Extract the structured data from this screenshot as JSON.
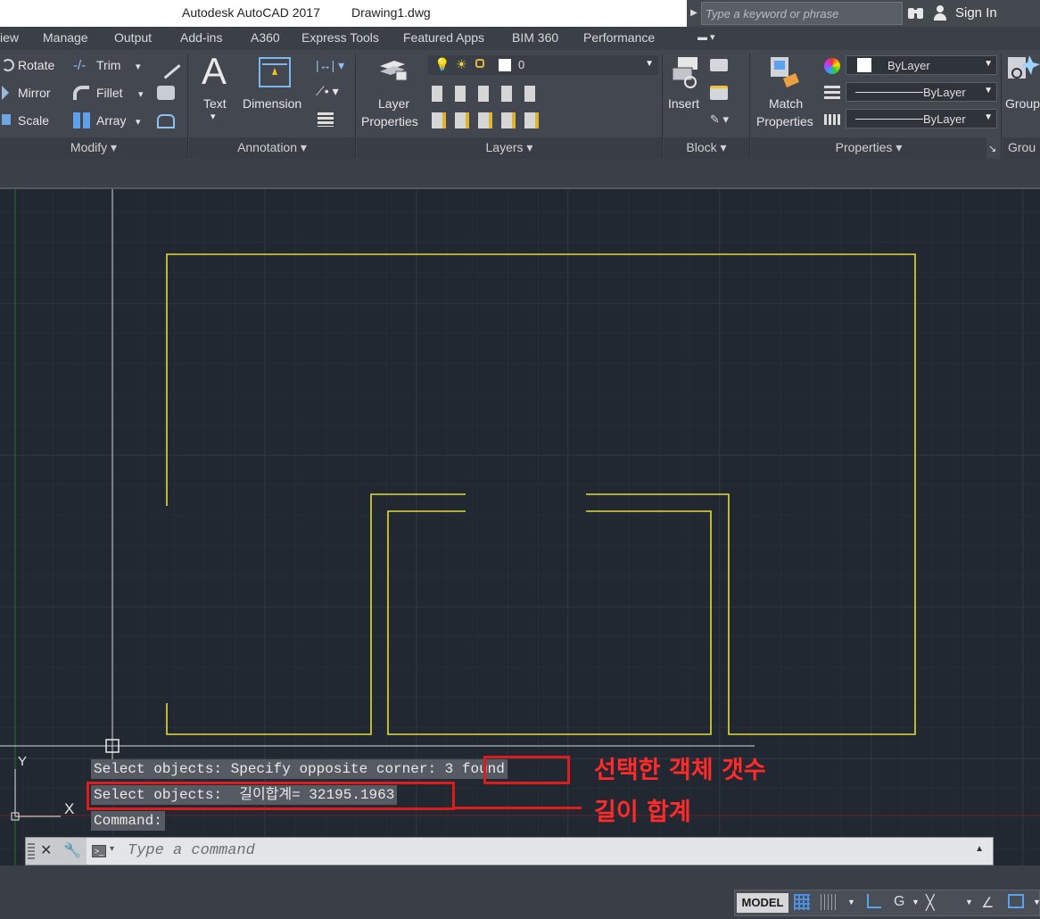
{
  "titlebar": {
    "app_title": "Autodesk AutoCAD 2017",
    "doc_title": "Drawing1.dwg",
    "search_placeholder": "Type a keyword or phrase",
    "sign_in": "Sign In"
  },
  "tabs": [
    "iew",
    "Manage",
    "Output",
    "Add-ins",
    "A360",
    "Express Tools",
    "Featured Apps",
    "BIM 360",
    "Performance"
  ],
  "ribbon": {
    "modify": {
      "rotate": "Rotate",
      "mirror": "Mirror",
      "scale": "Scale",
      "trim": "Trim",
      "fillet": "Fillet",
      "array": "Array",
      "panel": "Modify"
    },
    "annotation": {
      "text": "Text",
      "dimension": "Dimension",
      "panel": "Annotation"
    },
    "layers": {
      "layer_properties_line1": "Layer",
      "layer_properties_line2": "Properties",
      "current_layer": "0",
      "panel": "Layers"
    },
    "block": {
      "insert": "Insert",
      "panel": "Block"
    },
    "properties": {
      "match_line1": "Match",
      "match_line2": "Properties",
      "color": "ByLayer",
      "linetype": "ByLayer",
      "lineweight": "ByLayer",
      "panel": "Properties"
    },
    "groups": {
      "group": "Group",
      "panel": "Grou"
    }
  },
  "ucs": {
    "x": "X",
    "y": "Y"
  },
  "command_history": {
    "line1": "Select objects: Specify opposite corner:",
    "line1_count": "3 found",
    "line2": "Select objects:  길이합계= 32195.1963",
    "line3": "Command:"
  },
  "annotations": {
    "count_label": "선택한 객체 갯수",
    "length_label": "길이 합계"
  },
  "command_input": {
    "placeholder": "Type a command"
  },
  "statusbar": {
    "model": "MODEL"
  },
  "colors": {
    "drawing_line": "#e2dc3a",
    "highlight": "#e01b1b",
    "canvas": "#212831"
  }
}
